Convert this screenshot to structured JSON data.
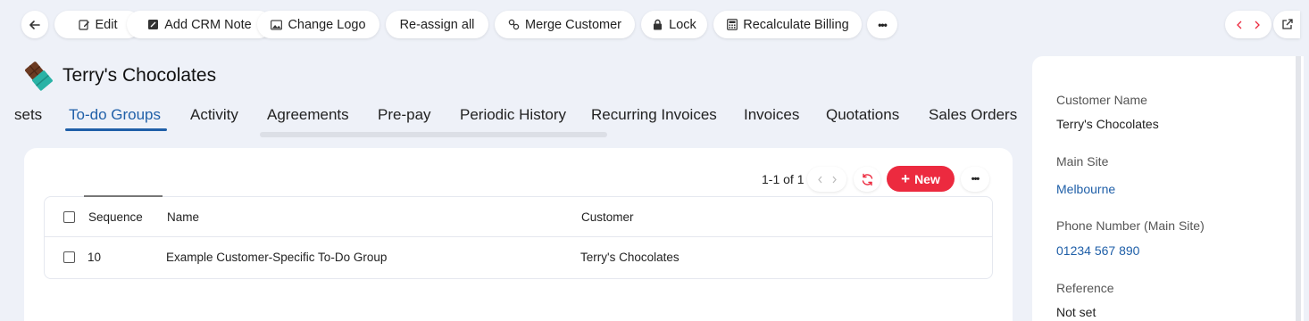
{
  "toolbar": {
    "edit_label": "Edit",
    "add_crm_note_label": "Add CRM Note",
    "change_logo_label": "Change Logo",
    "reassign_all_label": "Re-assign all",
    "merge_customer_label": "Merge Customer",
    "lock_label": "Lock",
    "recalculate_billing_label": "Recalculate Billing",
    "more_label": "•••"
  },
  "header": {
    "title": "Terry's Chocolates"
  },
  "tabs": [
    {
      "label": "sets"
    },
    {
      "label": "To-do Groups"
    },
    {
      "label": "Activity"
    },
    {
      "label": "Agreements"
    },
    {
      "label": "Pre-pay"
    },
    {
      "label": "Periodic History"
    },
    {
      "label": "Recurring Invoices"
    },
    {
      "label": "Invoices"
    },
    {
      "label": "Quotations"
    },
    {
      "label": "Sales Orders"
    }
  ],
  "list": {
    "pager_text": "1-1 of 1",
    "new_label": "New",
    "more_label": "•••",
    "columns": [
      "Sequence",
      "Name",
      "Customer"
    ],
    "rows": [
      {
        "sequence": "10",
        "name": "Example Customer-Specific To-Do Group",
        "customer": "Terry's Chocolates"
      }
    ]
  },
  "details": {
    "customer_name_label": "Customer Name",
    "customer_name_value": "Terry's Chocolates",
    "main_site_label": "Main Site",
    "main_site_value": "Melbourne",
    "phone_label": "Phone Number (Main Site)",
    "phone_value": "01234 567 890",
    "reference_label": "Reference",
    "reference_value": "Not set"
  },
  "colors": {
    "accent": "#1f5fa8",
    "new_button": "#ec2a3f",
    "nav_arrow": "#ec2a3f",
    "background": "#eef1f8"
  },
  "icons": [
    "arrow-left-icon",
    "edit-icon",
    "note-icon",
    "image-icon",
    "link-icon",
    "lock-icon",
    "calculator-icon",
    "more-icon",
    "chevron-left-icon",
    "chevron-right-icon",
    "external-link-icon",
    "refresh-icon",
    "plus-icon",
    "chocolate-logo-icon"
  ]
}
